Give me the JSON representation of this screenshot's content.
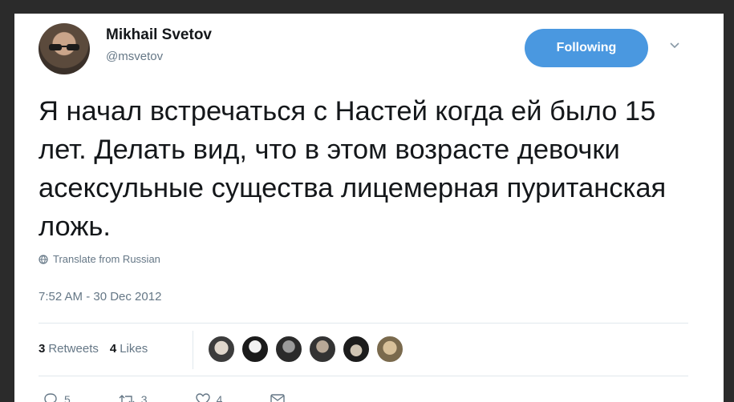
{
  "user": {
    "display_name": "Mikhail Svetov",
    "handle": "@msvetov"
  },
  "follow_button": {
    "label": "Following",
    "color": "#4a98e0"
  },
  "tweet": {
    "text": "Я начал встречаться с Настей когда ей было 15 лет. Делать вид, что в этом возрасте девочки асексульные существа лицемерная пуританская ложь.",
    "translate_label": "Translate from Russian",
    "timestamp": "7:52 AM - 30 Dec 2012"
  },
  "stats": {
    "retweets_count": "3",
    "retweets_label": "Retweets",
    "likes_count": "4",
    "likes_label": "Likes"
  },
  "actions": {
    "reply_count": "5",
    "retweet_count": "3",
    "like_count": "4"
  },
  "icons": [
    "avatar",
    "chevron-down-icon",
    "globe-icon",
    "reply-icon",
    "retweet-icon",
    "like-icon",
    "message-icon"
  ]
}
